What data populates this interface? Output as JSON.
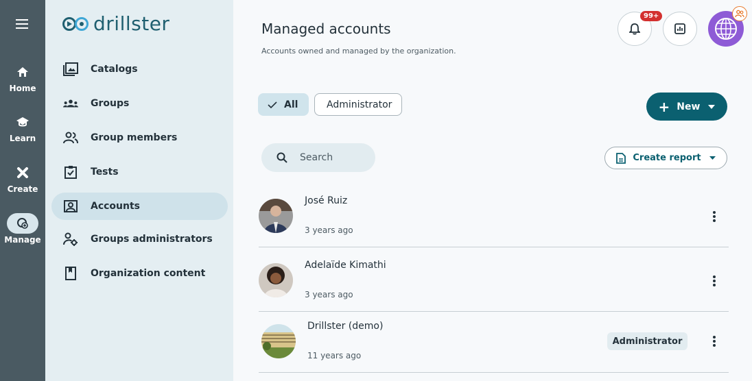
{
  "rail": {
    "items": [
      {
        "label": "Home",
        "icon": "home-icon"
      },
      {
        "label": "Learn",
        "icon": "graduation-cap-icon"
      },
      {
        "label": "Create",
        "icon": "tools-icon"
      },
      {
        "label": "Manage",
        "icon": "manage-icon"
      }
    ],
    "active": "Manage"
  },
  "sidebar": {
    "logo": "drillster",
    "items": [
      {
        "label": "Catalogs",
        "icon": "catalog-icon"
      },
      {
        "label": "Groups",
        "icon": "groups-icon"
      },
      {
        "label": "Group members",
        "icon": "group-members-icon"
      },
      {
        "label": "Tests",
        "icon": "tests-icon"
      },
      {
        "label": "Accounts",
        "icon": "accounts-icon"
      },
      {
        "label": "Groups administrators",
        "icon": "groups-admin-icon"
      },
      {
        "label": "Organization content",
        "icon": "organization-content-icon"
      }
    ],
    "active": "Accounts"
  },
  "header": {
    "title": "Managed accounts",
    "subtitle": "Accounts owned and managed by the organization.",
    "notification_badge": "99+"
  },
  "filters": {
    "all_label": "All",
    "admin_label": "Administrator"
  },
  "new_button": "New",
  "search": {
    "placeholder": "Search"
  },
  "report_button": "Create report",
  "accounts": [
    {
      "name": "José Ruiz",
      "time": "3 years ago"
    },
    {
      "name": "Adelaïde Kimathi",
      "time": "3 years ago"
    },
    {
      "name": "Drillster (demo)",
      "time": "11 years ago",
      "role": "Administrator"
    }
  ],
  "colors": {
    "rail": "#4a5a62",
    "sidebar": "#e4eef2",
    "accent": "#0b6070",
    "badge": "#d3302f"
  }
}
